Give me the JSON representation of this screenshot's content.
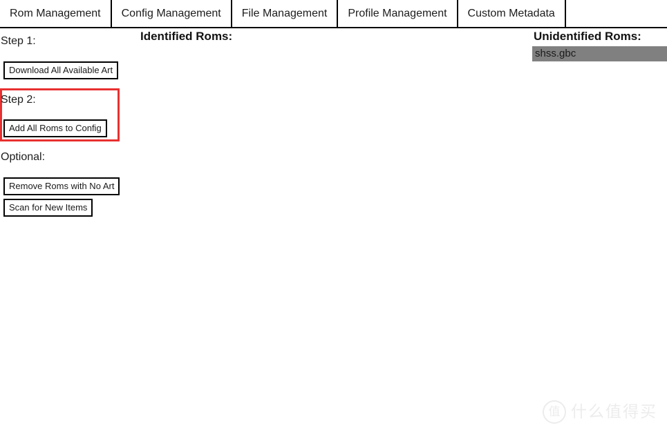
{
  "tabs": [
    {
      "label": "Rom Management"
    },
    {
      "label": "Config Management"
    },
    {
      "label": "File Management"
    },
    {
      "label": "Profile Management"
    },
    {
      "label": "Custom Metadata"
    }
  ],
  "left_panel": {
    "step1_label": "Step 1:",
    "download_art_button": "Download All Available Art",
    "step2_label": "Step 2:",
    "add_roms_button": "Add All Roms to Config",
    "optional_label": "Optional:",
    "remove_no_art_button": "Remove Roms with No Art",
    "scan_new_items_button": "Scan for New Items",
    "highlight_color": "#e83030"
  },
  "identified": {
    "heading": "Identified Roms:",
    "items": []
  },
  "unidentified": {
    "heading": "Unidentified Roms:",
    "items": [
      {
        "name": "shss.gbc",
        "selected": true
      }
    ],
    "selection_color": "#808080"
  },
  "watermark": {
    "logo_glyph": "值",
    "text": "什么值得买"
  }
}
